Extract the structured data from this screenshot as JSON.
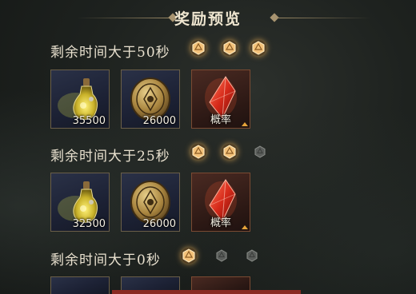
{
  "header": {
    "title": "奖励预览"
  },
  "tiers": [
    {
      "label": "剩余时间大于50秒",
      "stars": [
        "on",
        "on",
        "on"
      ],
      "items": [
        {
          "icon": "potion-icon",
          "count": "35500"
        },
        {
          "icon": "coin-icon",
          "count": "26000"
        },
        {
          "icon": "crystal-icon",
          "prob": "概率"
        }
      ]
    },
    {
      "label": "剩余时间大于25秒",
      "stars": [
        "on",
        "on",
        "off"
      ],
      "items": [
        {
          "icon": "potion-icon",
          "count": "32500"
        },
        {
          "icon": "coin-icon",
          "count": "26000"
        },
        {
          "icon": "crystal-icon",
          "prob": "概率"
        }
      ]
    },
    {
      "label": "剩余时间大于0秒",
      "stars": [
        "on",
        "off",
        "off"
      ],
      "items": []
    }
  ],
  "colors": {
    "star_on": "#e8b060",
    "star_off": "#7a7a78",
    "accent_red": "#8a2a22"
  }
}
